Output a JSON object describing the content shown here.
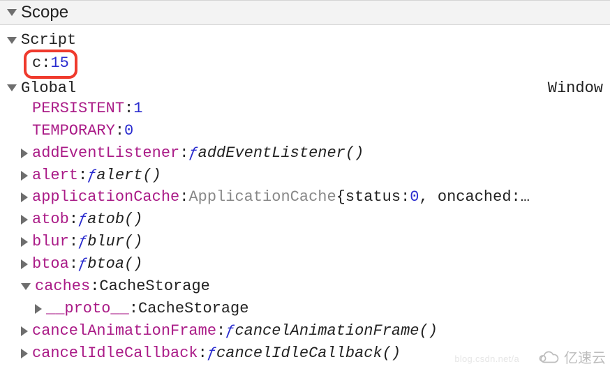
{
  "panel": {
    "title": "Scope"
  },
  "script": {
    "label": "Script",
    "highlight": {
      "name": "c",
      "value": "15"
    }
  },
  "global": {
    "label": "Global",
    "constructor": "Window",
    "constants": [
      {
        "name": "PERSISTENT",
        "value": "1"
      },
      {
        "name": "TEMPORARY",
        "value": "0"
      }
    ],
    "items": [
      {
        "type": "fn",
        "name": "addEventListener",
        "fn": "addEventListener()"
      },
      {
        "type": "fn",
        "name": "alert",
        "fn": "alert()"
      },
      {
        "type": "objinline",
        "name": "applicationCache",
        "ctor": "ApplicationCache",
        "inline_prop": "status",
        "inline_val": "0",
        "inline_tail": ", oncached:…"
      },
      {
        "type": "fn",
        "name": "atob",
        "fn": "atob()"
      },
      {
        "type": "fn",
        "name": "blur",
        "fn": "blur()"
      },
      {
        "type": "fn",
        "name": "btoa",
        "fn": "btoa()"
      },
      {
        "type": "objopen",
        "name": "caches",
        "ctor": "CacheStorage",
        "child": {
          "name": "__proto__",
          "ctor": "CacheStorage"
        }
      },
      {
        "type": "fn",
        "name": "cancelAnimationFrame",
        "fn": "cancelAnimationFrame()"
      },
      {
        "type": "fn",
        "name": "cancelIdleCallback",
        "fn": "cancelIdleCallback()"
      }
    ]
  },
  "watermark": {
    "text": "亿速云",
    "faint": "blog.csdn.net/a"
  }
}
